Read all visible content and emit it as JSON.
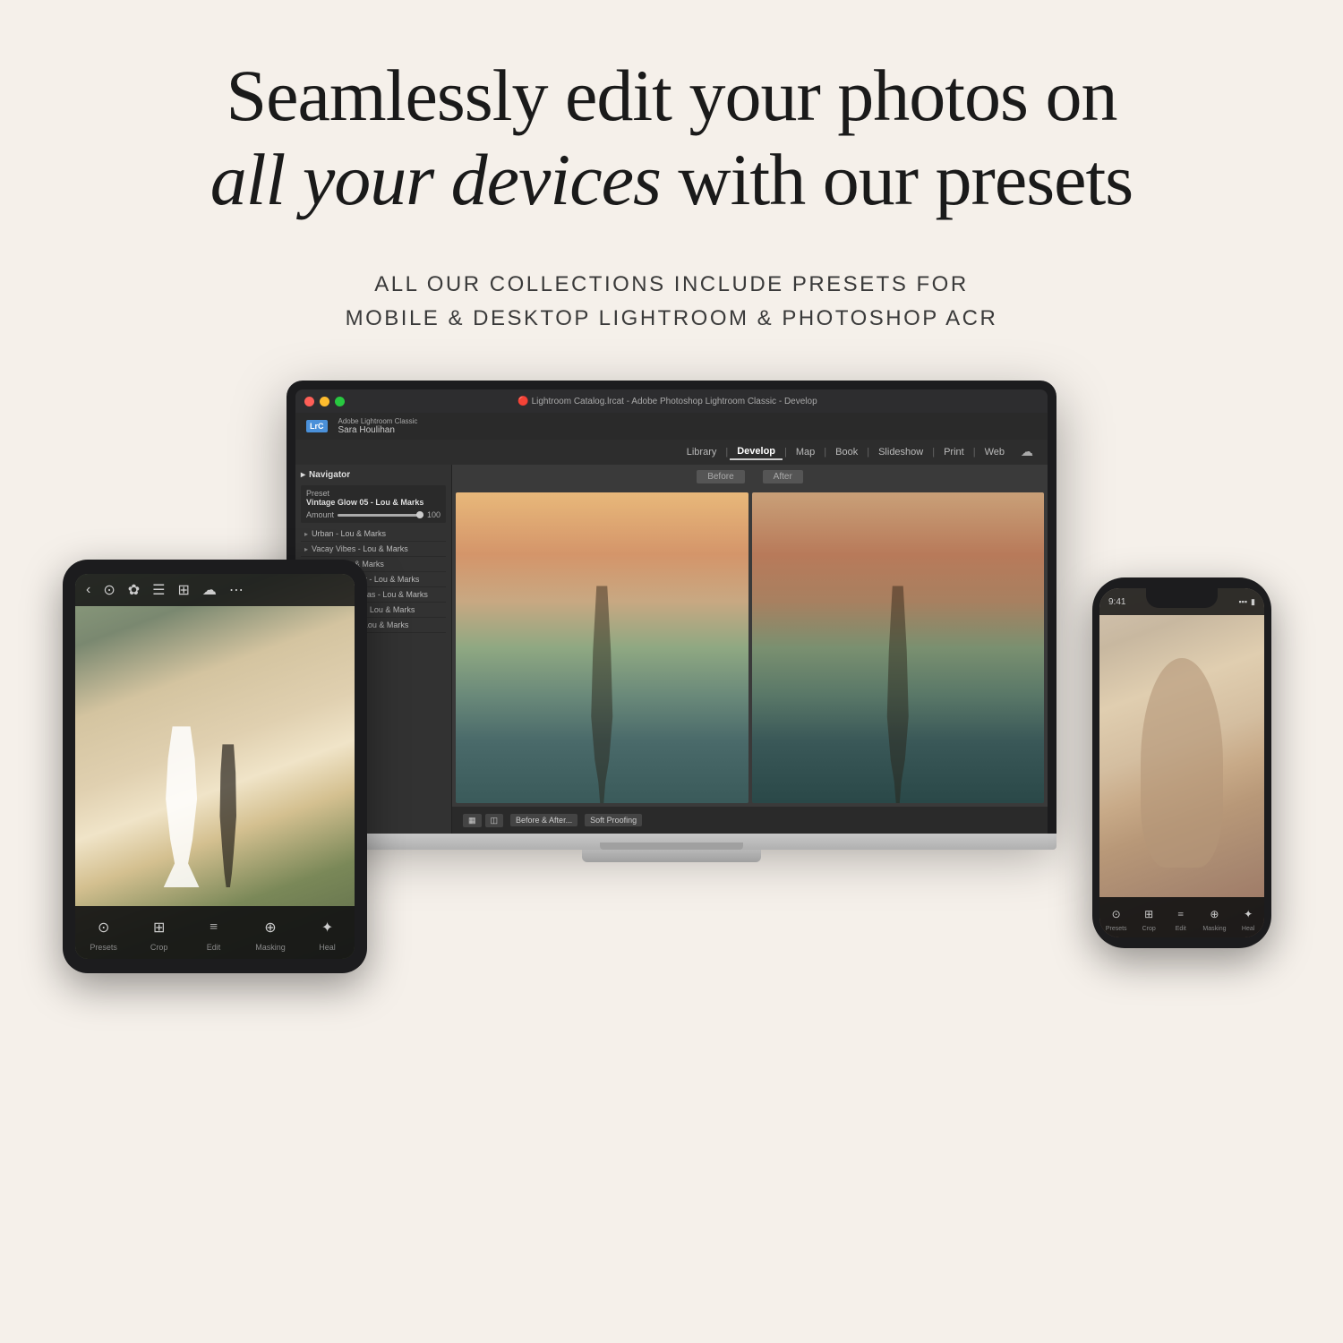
{
  "background_color": "#f5f0ea",
  "headline": {
    "line1": "Seamlessly edit your photos on",
    "italic_part": "all your devices",
    "line2_rest": " with our presets"
  },
  "subtitle": {
    "line1": "ALL OUR COLLECTIONS INCLUDE PRESETS FOR",
    "line2": "MOBILE & DESKTOP LIGHTROOM & PHOTOSHOP ACR"
  },
  "laptop": {
    "titlebar_text": "🔴 Lightroom Catalog.lrcat - Adobe Photoshop Lightroom Classic - Develop",
    "logo": "LrC",
    "user": "Sara Houlihan",
    "nav_items": [
      "Library",
      "Develop",
      "Map",
      "Book",
      "Slideshow",
      "Print",
      "Web"
    ],
    "active_nav": "Develop",
    "navigator_label": "Navigator",
    "preset_section_label": "Preset",
    "preset_name": "Vintage Glow 05 - Lou & Marks",
    "amount_label": "Amount",
    "amount_value": "100",
    "presets": [
      "Urban - Lou & Marks",
      "Vacay Vibes - Lou & Marks",
      "Vibes - Lou & Marks",
      "Vibrant Blogger - Lou & Marks",
      "Vibrant Christmas - Lou & Marks",
      "Vibrant Spring - Lou & Marks",
      "Vintage Film - Lou & Marks"
    ],
    "before_label": "Before",
    "after_label": "After",
    "bottom_bar_label": "Before & After..."
  },
  "tablet": {
    "back_icon": "‹",
    "tools": [
      {
        "icon": "⊙",
        "label": "Presets"
      },
      {
        "icon": "⊞",
        "label": "Crop"
      },
      {
        "icon": "≡",
        "label": "Edit"
      },
      {
        "icon": "⊕",
        "label": "Masking"
      },
      {
        "icon": "✦",
        "label": "Heal"
      }
    ]
  },
  "phone": {
    "time": "9:41",
    "tools": [
      {
        "icon": "⊙",
        "label": "Presets"
      },
      {
        "icon": "⊞",
        "label": "Crop"
      },
      {
        "icon": "≡",
        "label": "Edit"
      },
      {
        "icon": "⊕",
        "label": "Masking"
      },
      {
        "icon": "✦",
        "label": "Heal"
      }
    ]
  }
}
